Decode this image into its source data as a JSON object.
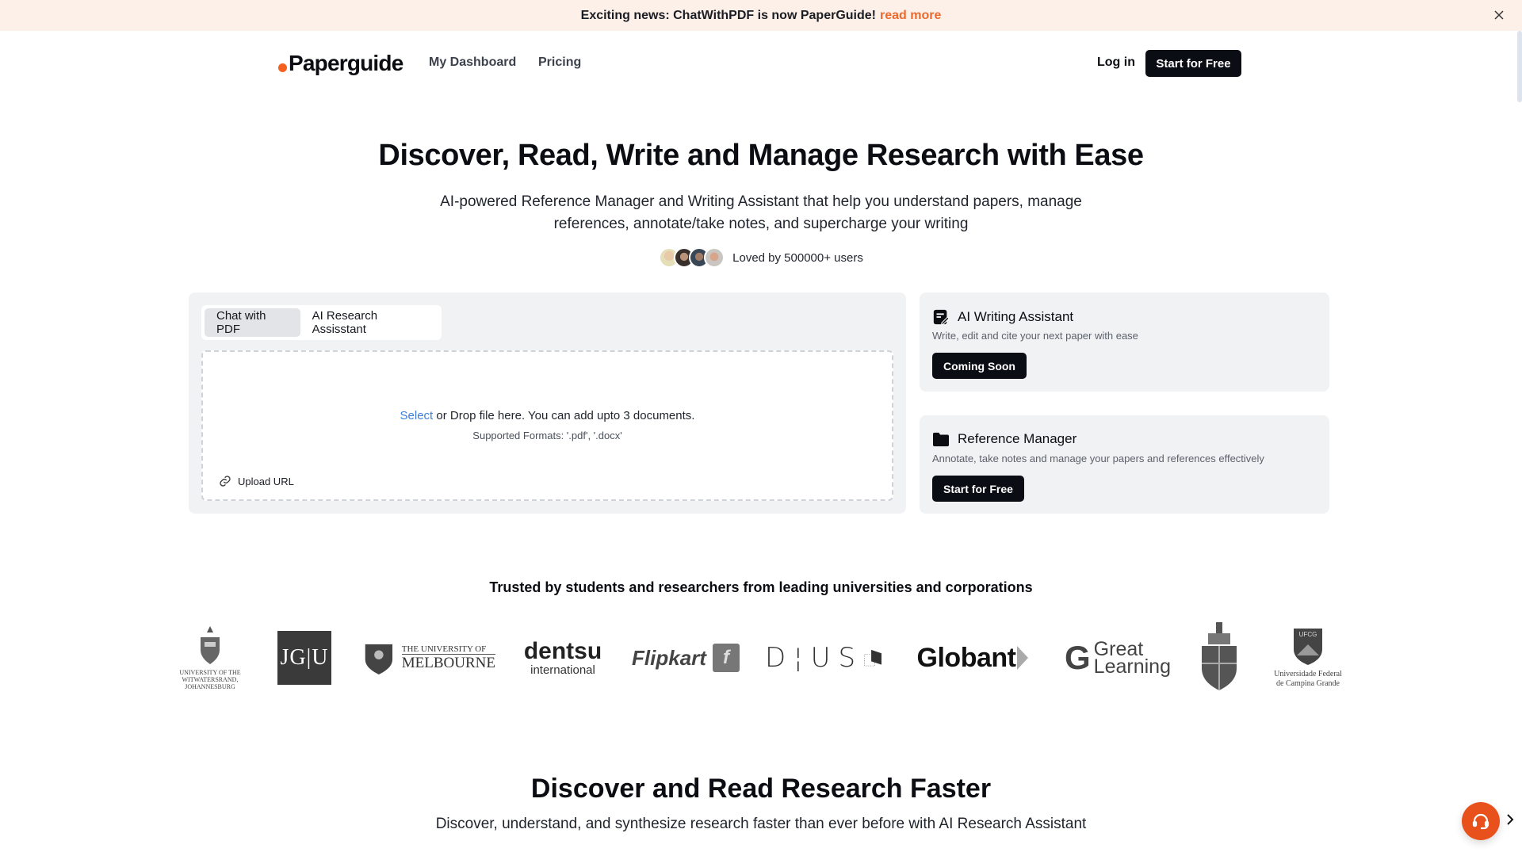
{
  "banner": {
    "text": "Exciting news: ChatWithPDF is now PaperGuide!",
    "link": "read more",
    "close_icon": "close-icon"
  },
  "nav": {
    "logo": "Paperguide",
    "links": [
      "My Dashboard",
      "Pricing"
    ],
    "login": "Log in",
    "cta": "Start for Free"
  },
  "hero": {
    "title": "Discover, Read, Write and Manage Research with Ease",
    "subtitle": "AI-powered Reference Manager and Writing Assistant that help you understand papers, manage references, annotate/take notes, and supercharge your writing",
    "social_proof": "Loved by 500000+ users"
  },
  "upload_panel": {
    "tabs": [
      {
        "label": "Chat with PDF",
        "active": true
      },
      {
        "label": "AI Research Assisstant",
        "active": false
      }
    ],
    "select_link": "Select",
    "drop_text": " or Drop file here. You can add upto 3 documents.",
    "formats": "Supported Formats: '.pdf', '.docx'",
    "upload_url": "Upload URL"
  },
  "cards": [
    {
      "icon": "edit-note-icon",
      "title": "AI Writing Assistant",
      "description": "Write, edit and cite your next paper with ease",
      "button": "Coming Soon"
    },
    {
      "icon": "folder-icon",
      "title": "Reference Manager",
      "description": "Annotate, take notes and manage your papers and references effectively",
      "button": "Start for Free"
    }
  ],
  "trusted": {
    "heading": "Trusted by students and researchers from leading universities and corporations",
    "logos": [
      "University of the Witwatersrand, Johannesburg",
      "JGU",
      "The University of Melbourne",
      "dentsu international",
      "Flipkart",
      "DIUS",
      "Globant",
      "Great Learning",
      "University of Pretoria",
      "Universidade Federal de Campina Grande"
    ]
  },
  "section2": {
    "title": "Discover and Read Research Faster",
    "subtitle": "Discover, understand, and synthesize research faster than ever before with AI Research Assistant"
  },
  "colors": {
    "accent": "#ec6a2c",
    "brand_dot": "#f4601f",
    "dark_button": "#0b0d14",
    "link_blue": "#3d7fd9",
    "banner_bg": "#fdf0e9",
    "panel_bg": "#f1f2f4"
  }
}
